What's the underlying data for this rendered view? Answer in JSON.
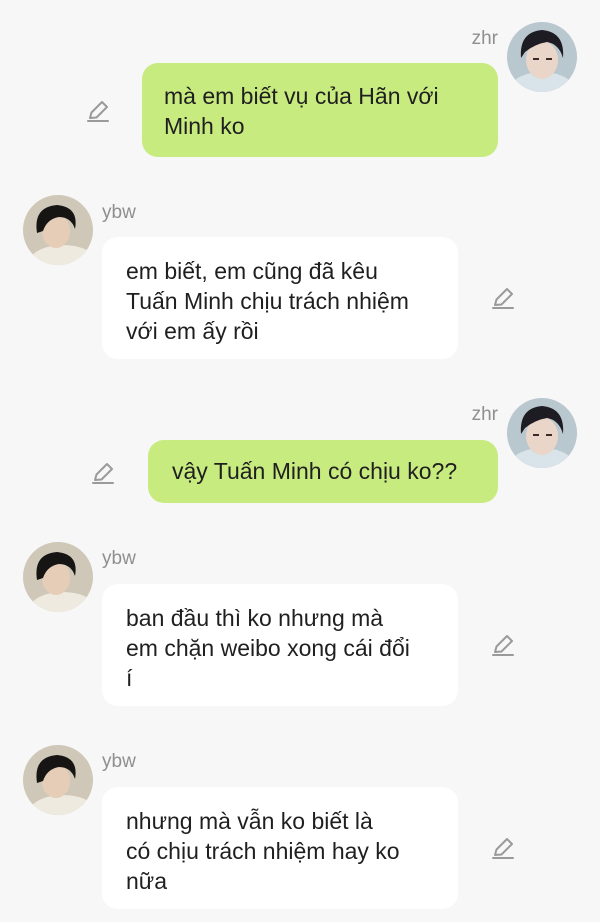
{
  "messages": [
    {
      "sender": "zhr",
      "side": "right",
      "lines": [
        "mà em biết vụ của Hãn với",
        "Minh ko"
      ],
      "edit_icon": "pencil-icon"
    },
    {
      "sender": "ybw",
      "side": "left",
      "lines": [
        "em biết, em cũng đã kêu",
        "Tuấn Minh chịu trách nhiệm",
        "với em ấy rồi"
      ],
      "edit_icon": "pencil-icon"
    },
    {
      "sender": "zhr",
      "side": "right",
      "lines": [
        "vậy Tuấn Minh có chịu ko??"
      ],
      "edit_icon": "pencil-icon"
    },
    {
      "sender": "ybw",
      "side": "left",
      "lines": [
        "ban đầu thì ko nhưng mà",
        "em chặn weibo xong cái đổi",
        "í"
      ],
      "edit_icon": "pencil-icon"
    },
    {
      "sender": "ybw",
      "side": "left",
      "lines": [
        "nhưng mà vẫn ko biết là",
        "có chịu trách nhiệm hay ko",
        "nữa"
      ],
      "edit_icon": "pencil-icon"
    }
  ],
  "colors": {
    "background": "#f7f7f7",
    "my_bubble": "#c8eb7f",
    "other_bubble": "#ffffff",
    "name_text": "#8f8f8f",
    "icon": "#9a9a9a"
  }
}
